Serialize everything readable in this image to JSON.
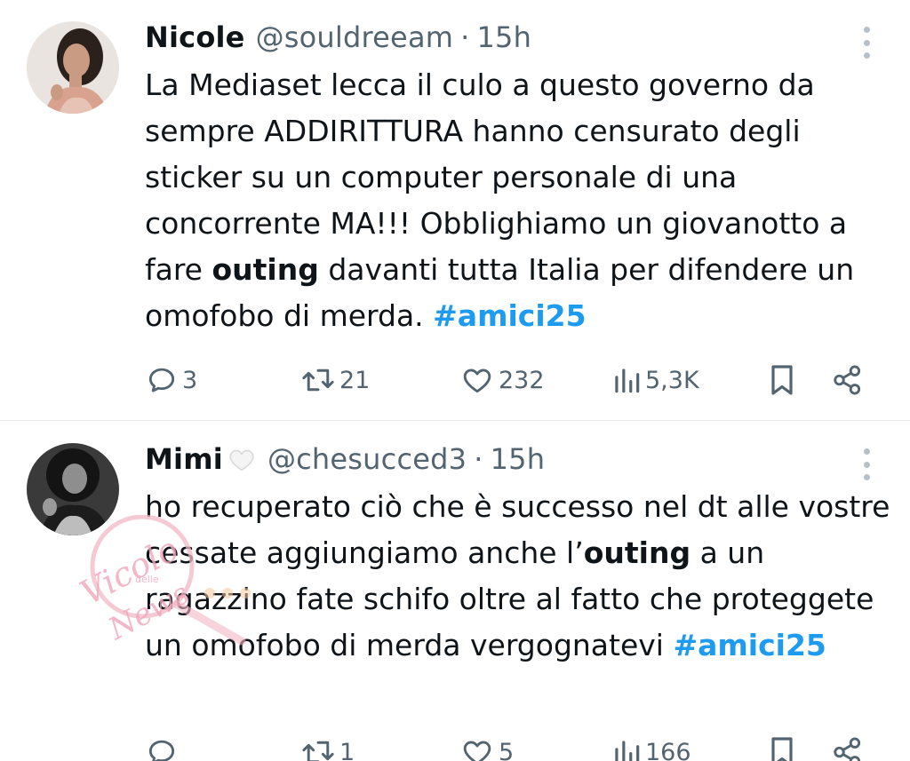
{
  "tweets": [
    {
      "name": "Nicole",
      "handle": "@souldreeam",
      "separator": "·",
      "time": "15h",
      "text_parts": [
        "La Mediaset lecca il culo a questo governo da sempre ADDIRITTURA hanno censurato degli sticker su un computer personale di una concorrente MA!!! Obblighiamo un giovanotto a fare ",
        "outing",
        " davanti tutta Italia per difendere un omofobo di merda. ",
        "#amici25"
      ],
      "replies": "3",
      "retweets": "21",
      "likes": "232",
      "views": "5,3K"
    },
    {
      "name": "Mimi",
      "handle": "@chesucced3",
      "separator": "·",
      "time": "15h",
      "text_parts": [
        "ho recuperato ciò che è successo nel dt alle vostre cessate aggiungiamo anche l’",
        "outing",
        " a un ragazzino fate schifo oltre al fatto che proteggete un omofobo di merda vergognatevi ",
        "#amici25"
      ],
      "replies": "",
      "retweets": "1",
      "likes": "5",
      "views": "166"
    }
  ],
  "watermark": {
    "line1": "Vicolo",
    "line2": "delle",
    "line3": "News"
  },
  "colors": {
    "hashtag": "#1d9bf0",
    "secondary": "#536471",
    "text": "#0f1419"
  }
}
